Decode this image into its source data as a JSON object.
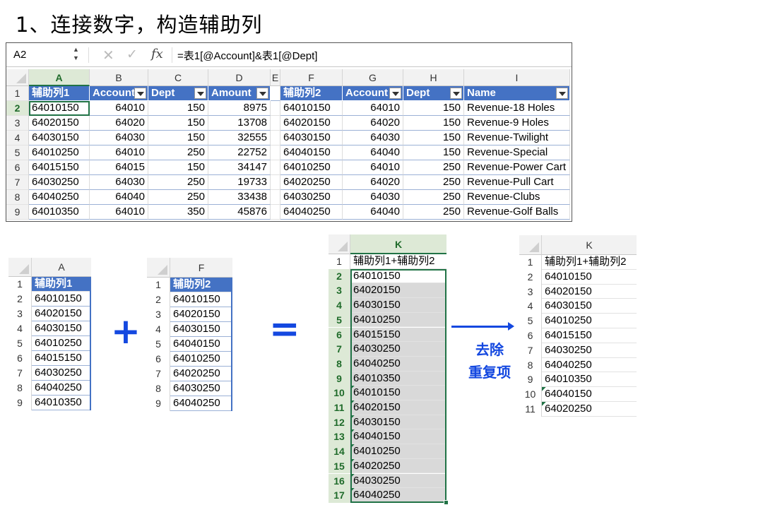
{
  "title": "1、连接数字，构造辅助列",
  "formula_bar": {
    "name_box": "A2",
    "cancel_symbol": "✕",
    "enter_symbol": "✓",
    "fx_label": "fx",
    "formula": "=表1[@Account]&表1[@Dept]"
  },
  "sheet": {
    "columns": [
      "A",
      "B",
      "C",
      "D",
      "E",
      "F",
      "G",
      "H",
      "I"
    ],
    "rows": [
      "1",
      "2",
      "3",
      "4",
      "5",
      "6",
      "7",
      "8",
      "9"
    ],
    "header": [
      "辅助列1",
      "Account",
      "Dept",
      "Amount",
      "",
      "辅助列2",
      "Account",
      "Dept",
      "Name"
    ],
    "data": [
      [
        "64010150",
        "64010",
        "150",
        "8975",
        "",
        "64010150",
        "64010",
        "150",
        "Revenue-18 Holes"
      ],
      [
        "64020150",
        "64020",
        "150",
        "13708",
        "",
        "64020150",
        "64020",
        "150",
        "Revenue-9 Holes"
      ],
      [
        "64030150",
        "64030",
        "150",
        "32555",
        "",
        "64030150",
        "64030",
        "150",
        "Revenue-Twilight"
      ],
      [
        "64010250",
        "64010",
        "250",
        "22752",
        "",
        "64040150",
        "64040",
        "150",
        "Revenue-Special"
      ],
      [
        "64015150",
        "64015",
        "150",
        "34147",
        "",
        "64010250",
        "64010",
        "250",
        "Revenue-Power Cart"
      ],
      [
        "64030250",
        "64030",
        "250",
        "19733",
        "",
        "64020250",
        "64020",
        "250",
        "Revenue-Pull Cart"
      ],
      [
        "64040250",
        "64040",
        "250",
        "33438",
        "",
        "64030250",
        "64030",
        "250",
        "Revenue-Clubs"
      ],
      [
        "64010350",
        "64010",
        "350",
        "45876",
        "",
        "64040250",
        "64040",
        "250",
        "Revenue-Golf Balls"
      ]
    ]
  },
  "mini_a": {
    "col": "A",
    "header": "辅助列1",
    "rows": [
      "1",
      "2",
      "3",
      "4",
      "5",
      "6",
      "7",
      "8",
      "9"
    ],
    "values": [
      "64010150",
      "64020150",
      "64030150",
      "64010250",
      "64015150",
      "64030250",
      "64040250",
      "64010350"
    ]
  },
  "plus": "+",
  "mini_f": {
    "col": "F",
    "header": "辅助列2",
    "rows": [
      "1",
      "2",
      "3",
      "4",
      "5",
      "6",
      "7",
      "8",
      "9"
    ],
    "values": [
      "64010150",
      "64020150",
      "64030150",
      "64040150",
      "64010250",
      "64020250",
      "64030250",
      "64040250"
    ]
  },
  "equals": "=",
  "mini_k": {
    "col": "K",
    "header": "辅助列1+辅助列2",
    "rows": [
      "1",
      "2",
      "3",
      "4",
      "5",
      "6",
      "7",
      "8",
      "9",
      "10",
      "11",
      "12",
      "13",
      "14",
      "15",
      "16",
      "17"
    ],
    "values": [
      "64010150",
      "64020150",
      "64030150",
      "64010250",
      "64015150",
      "64030250",
      "64040250",
      "64010350",
      "64010150",
      "64020150",
      "64030150",
      "64040150",
      "64010250",
      "64020250",
      "64030250",
      "64040250"
    ]
  },
  "arrow_label": {
    "line1": "去除",
    "line2": "重复项"
  },
  "mini_k2": {
    "col": "K",
    "header": "辅助列1+辅助列2",
    "rows": [
      "1",
      "2",
      "3",
      "4",
      "5",
      "6",
      "7",
      "8",
      "9",
      "10",
      "11"
    ],
    "values": [
      "64010150",
      "64020150",
      "64030150",
      "64010250",
      "64015150",
      "64030250",
      "64040250",
      "64010350",
      "64040150",
      "64020250"
    ]
  },
  "colors": {
    "table_header": "#4472c4",
    "excel_green": "#217346",
    "annotation_blue": "#1448e0",
    "selection_gray": "#d9d9d9"
  }
}
